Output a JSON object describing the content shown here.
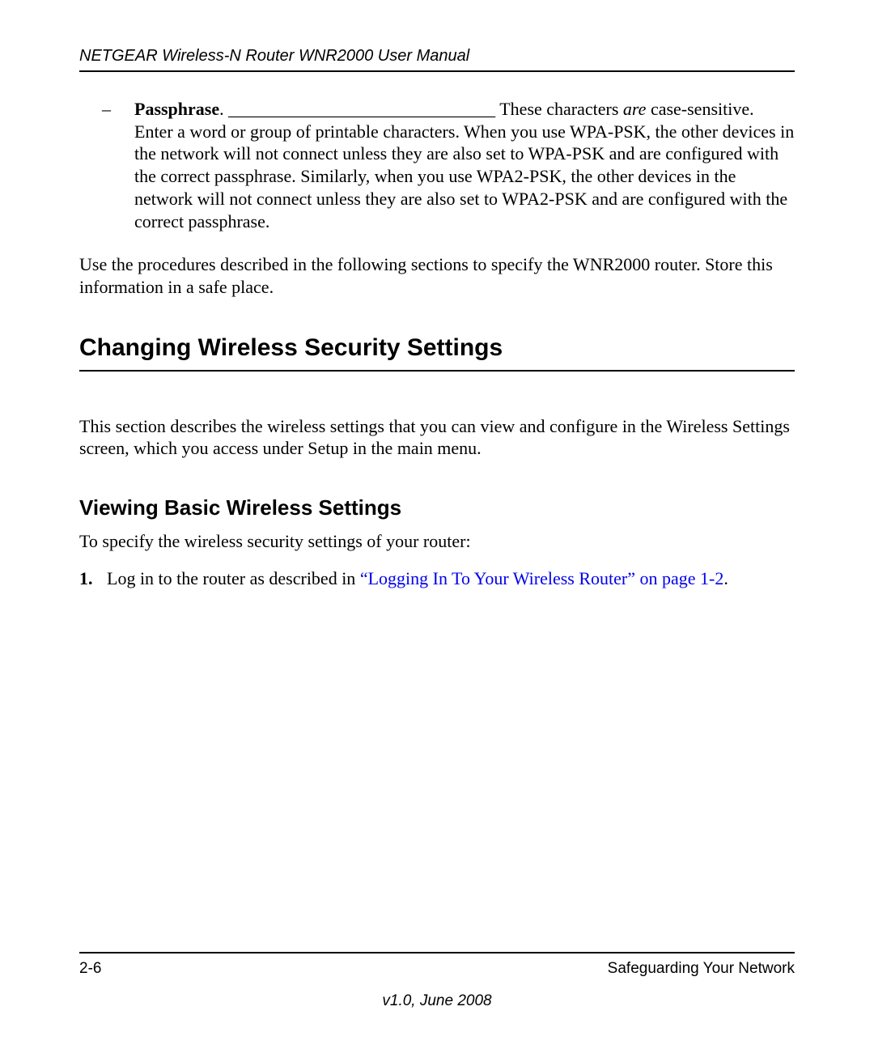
{
  "header": {
    "title": "NETGEAR Wireless-N Router WNR2000 User Manual"
  },
  "passphrase_item": {
    "dash": "–",
    "bold": "Passphrase",
    "dot": ". ",
    "fill": "______________________________ ",
    "pre_italic": "These characters ",
    "italic": "are",
    "post_italic": " case-sensitive. Enter a word or group of printable characters. When you use WPA-PSK, the other devices in the network will not connect unless they are also set to WPA-PSK and are configured with the correct passphrase. Similarly, when you use WPA2-PSK, the other devices in the network will not connect unless they are also set to WPA2-PSK and are configured with the correct passphrase."
  },
  "store_info_para": "Use the procedures described in the following sections to specify the WNR2000 router. Store this information in a safe place.",
  "h1": "Changing Wireless Security Settings",
  "h1_para": "This section describes the wireless settings that you can view and configure in the Wireless Settings screen, which you access under Setup in the main menu.",
  "h2": "Viewing Basic Wireless Settings",
  "h2_para": "To specify the wireless security settings of your router:",
  "steps": {
    "num1": "1.",
    "step1_pre": "Log in to the router as described in ",
    "step1_link": "“Logging In To Your Wireless Router” on page 1-2",
    "step1_post": "."
  },
  "footer": {
    "page_num": "2-6",
    "section": "Safeguarding Your Network",
    "version": "v1.0, June 2008"
  }
}
